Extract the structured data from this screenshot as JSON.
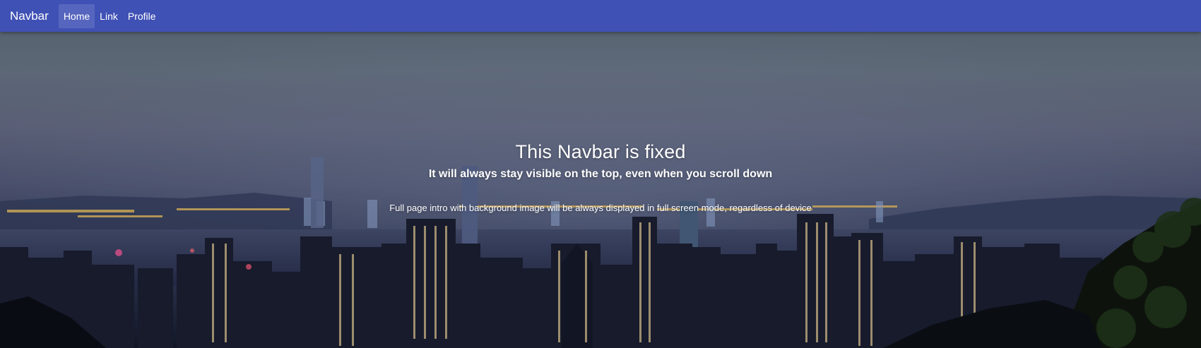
{
  "navbar": {
    "brand": "Navbar",
    "items": [
      {
        "label": "Home",
        "active": true
      },
      {
        "label": "Link",
        "active": false
      },
      {
        "label": "Profile",
        "active": false
      }
    ],
    "color": "#3f51b5"
  },
  "hero": {
    "title": "This Navbar is fixed",
    "subtitle": "It will always stay visible on the top, even when you scroll down",
    "description": "Full page intro with background image will be always displayed in full screen mode, regardless of device"
  }
}
